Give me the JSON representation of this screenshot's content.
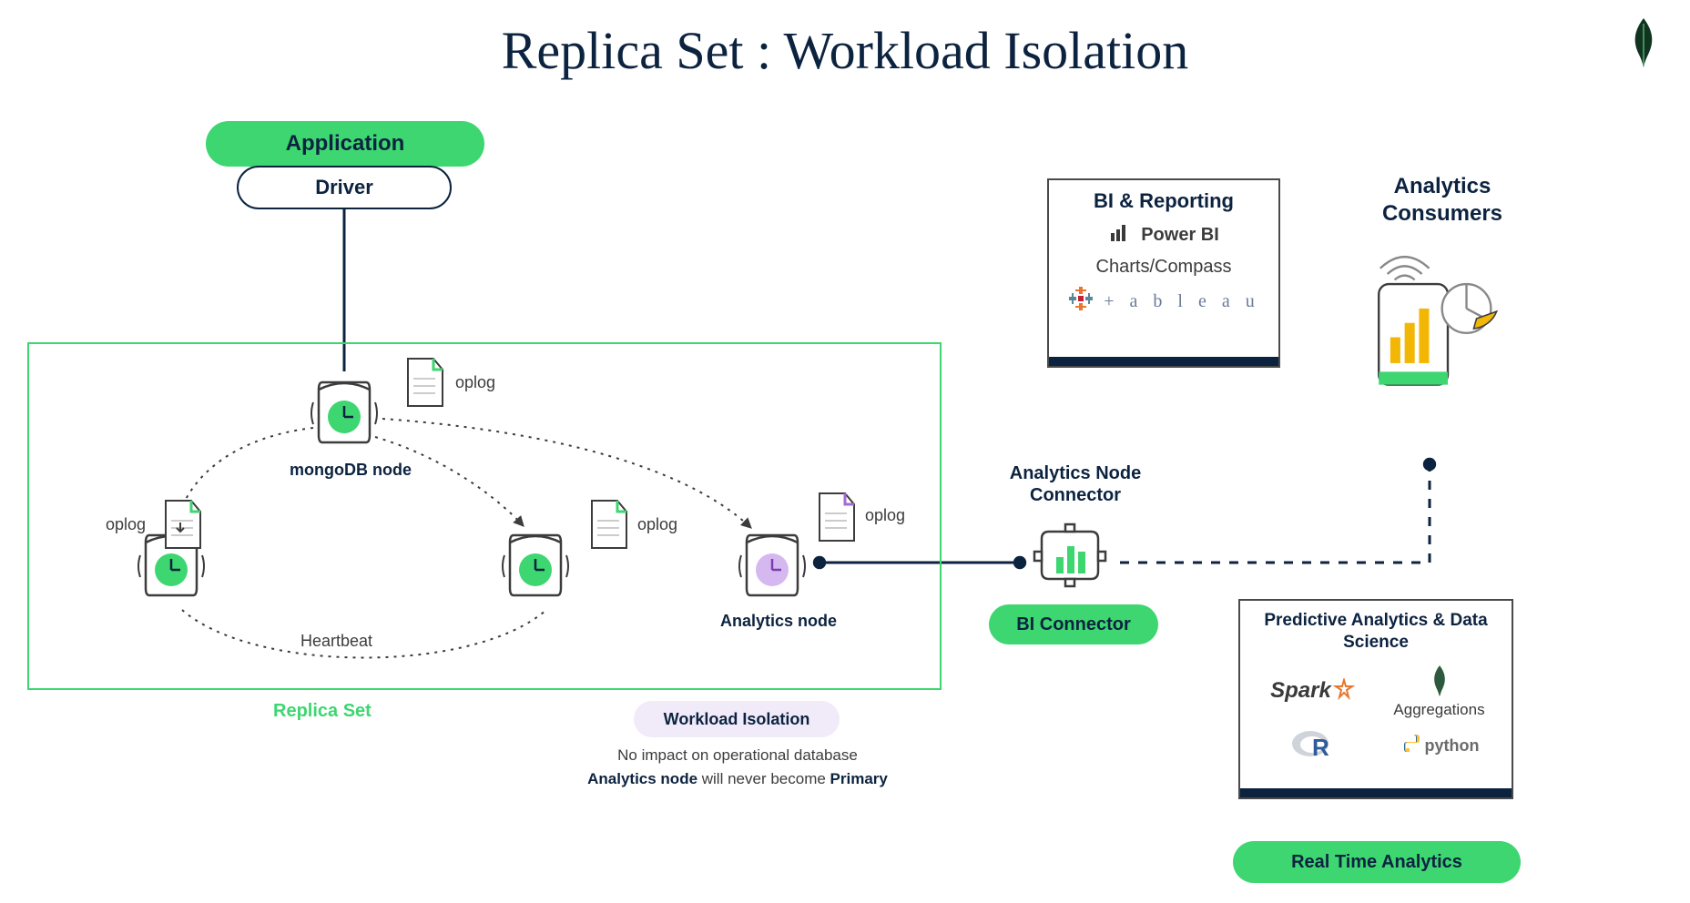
{
  "title": "Replica Set : Workload Isolation",
  "app": {
    "application_label": "Application",
    "driver_label": "Driver"
  },
  "replica_set": {
    "label": "Replica Set",
    "primary_label": "mongoDB node",
    "analytics_label": "Analytics node",
    "heartbeat_label": "Heartbeat",
    "oplog_label": "oplog"
  },
  "workload_isolation": {
    "pill_label": "Workload Isolation",
    "line1": "No impact on operational database",
    "line2_prefix": "Analytics node",
    "line2_mid": " will never become ",
    "line2_suffix": "Primary"
  },
  "connector": {
    "title": "Analytics Node Connector",
    "pill_label": "BI Connector"
  },
  "bi_box": {
    "title": "BI & Reporting",
    "powerbi": "Power BI",
    "charts_compass": "Charts/Compass",
    "tableau": "+ a b l e a u"
  },
  "analytics_consumers": {
    "title": "Analytics Consumers"
  },
  "ds_box": {
    "title": "Predictive Analytics & Data Science",
    "spark": "Spark",
    "aggregations": "Aggregations",
    "r": "R",
    "python": "python"
  },
  "rta_pill": "Real Time Analytics",
  "colors": {
    "green": "#3dd670",
    "purple": "#a36bd6",
    "dark": "#0c2340"
  }
}
